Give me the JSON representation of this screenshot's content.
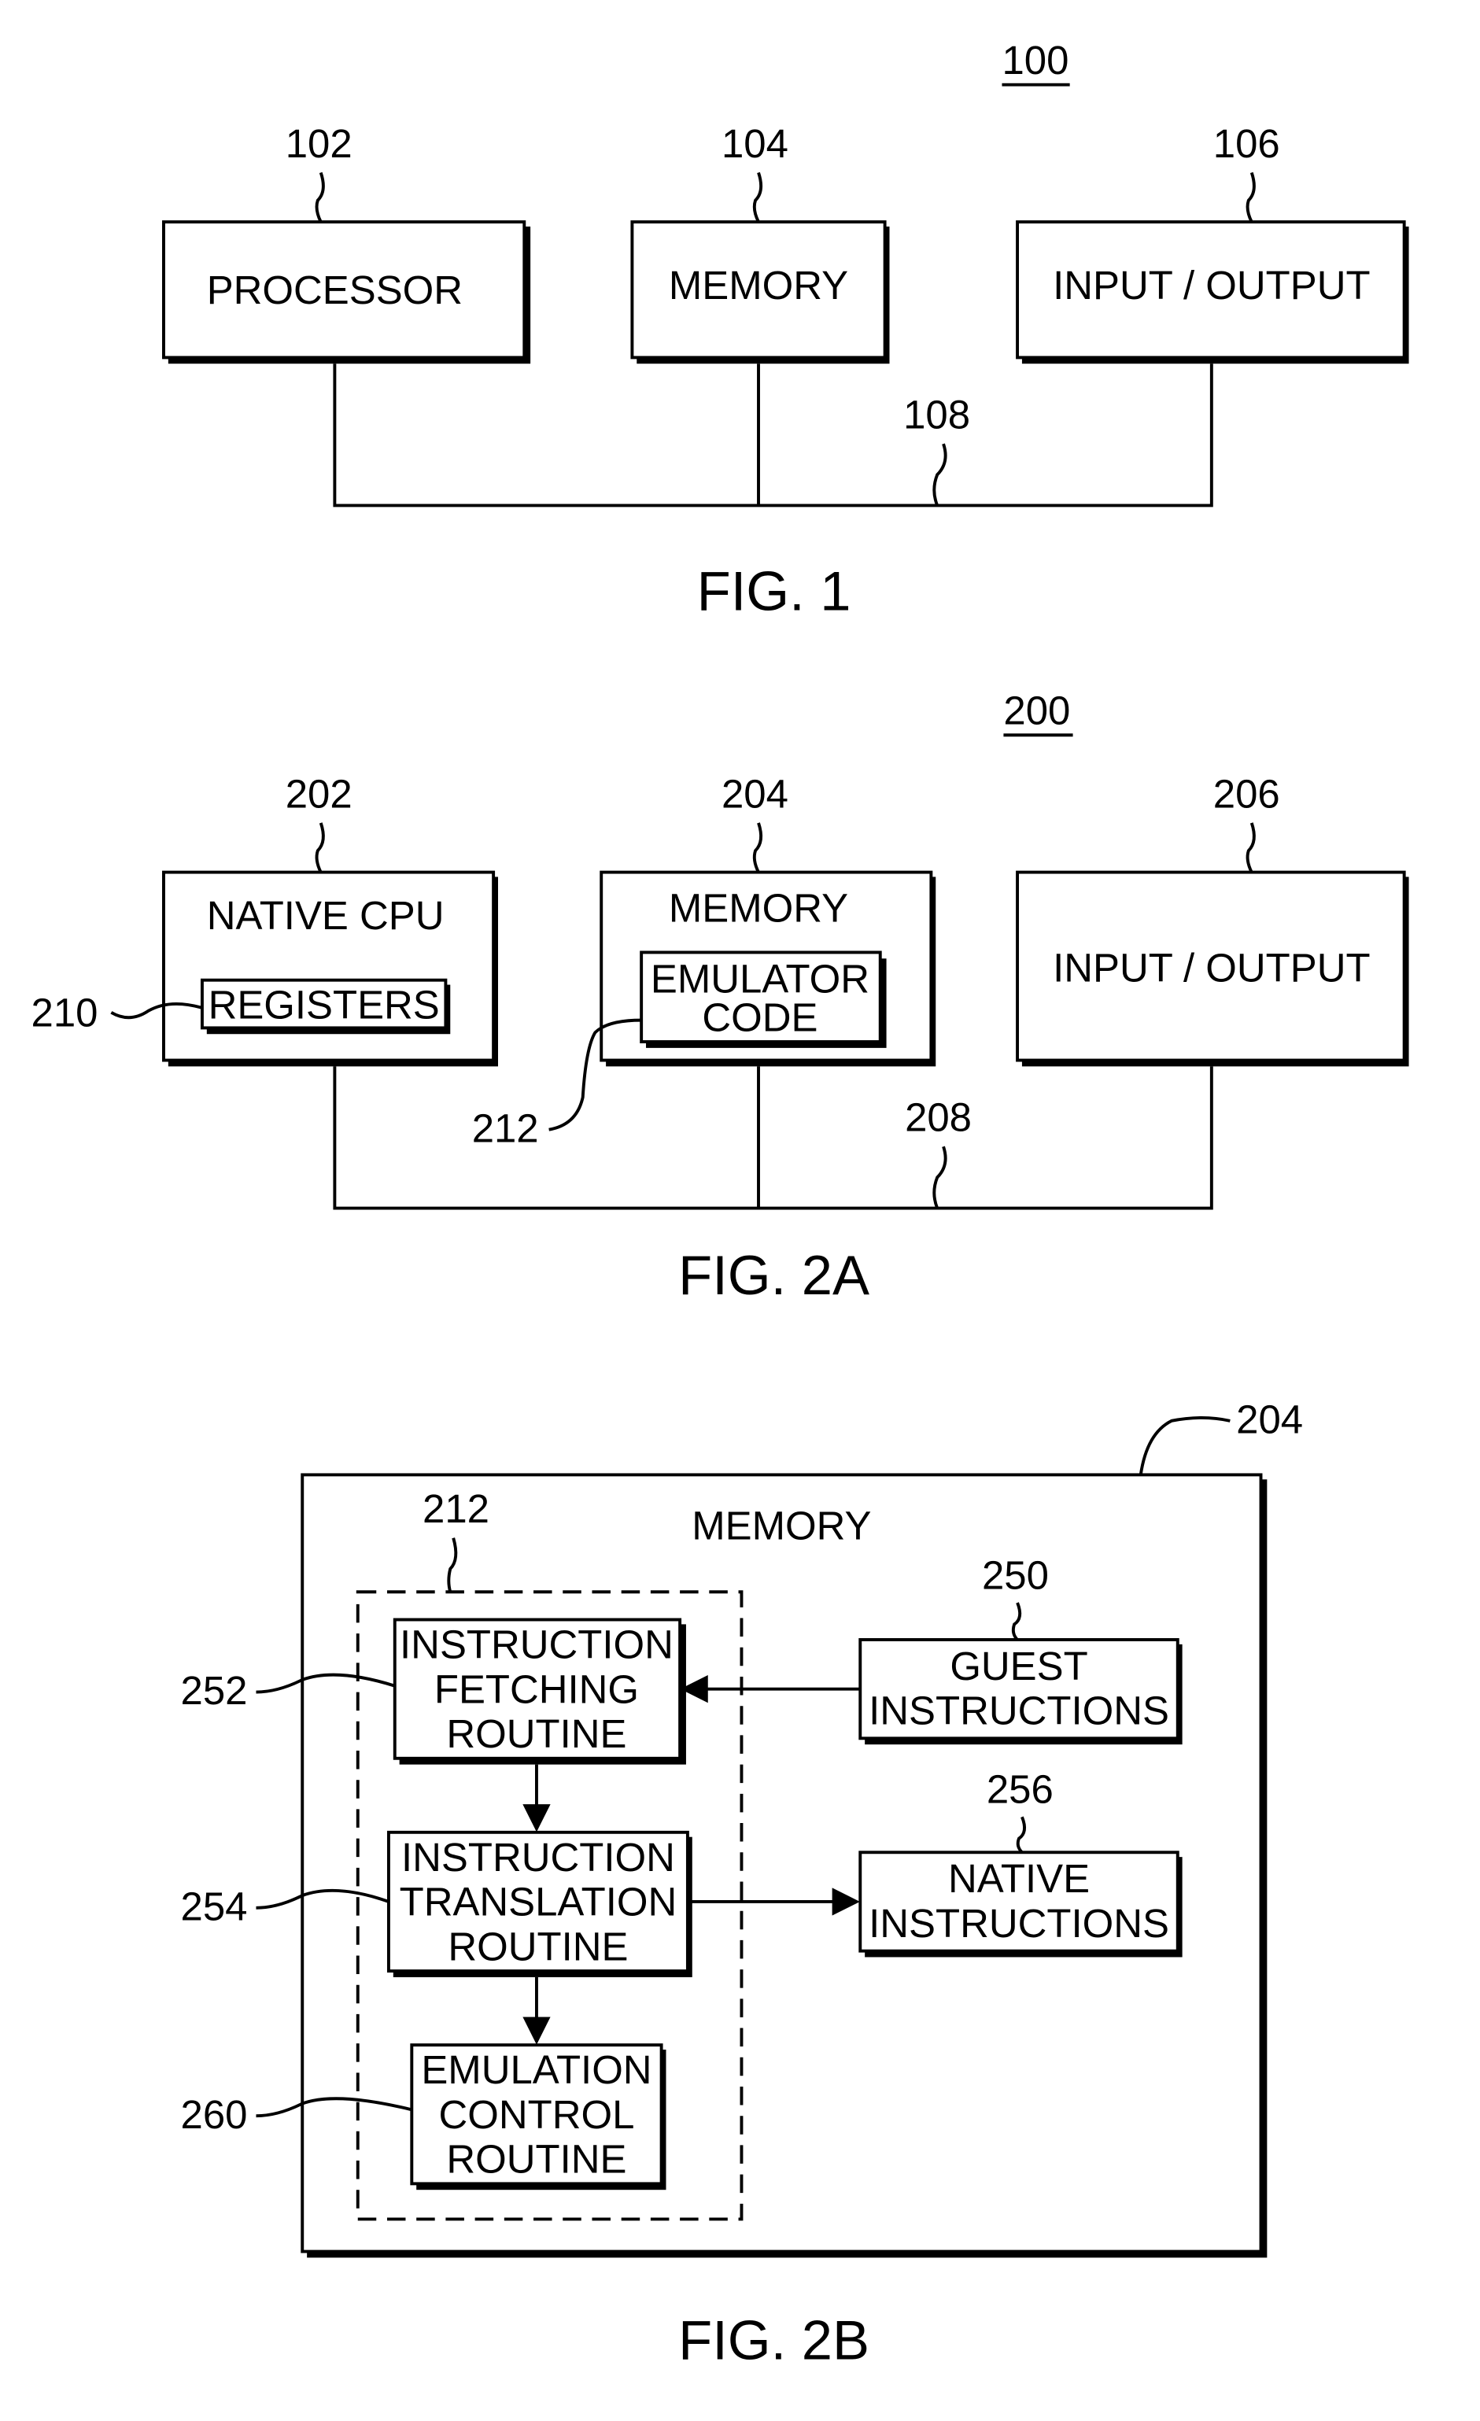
{
  "fig1": {
    "ref_overall": "100",
    "processor": {
      "ref": "102",
      "label": "PROCESSOR"
    },
    "memory": {
      "ref": "104",
      "label": "MEMORY"
    },
    "io": {
      "ref": "106",
      "label": "INPUT / OUTPUT"
    },
    "bus_ref": "108",
    "caption": "FIG. 1"
  },
  "fig2a": {
    "ref_overall": "200",
    "cpu": {
      "ref": "202",
      "label": "NATIVE CPU"
    },
    "registers": {
      "ref": "210",
      "label": "REGISTERS"
    },
    "memory": {
      "ref": "204",
      "label": "MEMORY"
    },
    "emulator": {
      "ref": "212",
      "label_line1": "EMULATOR",
      "label_line2": "CODE"
    },
    "io": {
      "ref": "206",
      "label": "INPUT / OUTPUT"
    },
    "bus_ref": "208",
    "caption": "FIG. 2A"
  },
  "fig2b": {
    "memory": {
      "ref": "204",
      "label": "MEMORY"
    },
    "emulator_group_ref": "212",
    "fetching": {
      "ref": "252",
      "lines": [
        "INSTRUCTION",
        "FETCHING",
        "ROUTINE"
      ]
    },
    "translation": {
      "ref": "254",
      "lines": [
        "INSTRUCTION",
        "TRANSLATION",
        "ROUTINE"
      ]
    },
    "control": {
      "ref": "260",
      "lines": [
        "EMULATION",
        "CONTROL",
        "ROUTINE"
      ]
    },
    "guest": {
      "ref": "250",
      "lines": [
        "GUEST",
        "INSTRUCTIONS"
      ]
    },
    "native": {
      "ref": "256",
      "lines": [
        "NATIVE",
        "INSTRUCTIONS"
      ]
    },
    "caption": "FIG. 2B"
  }
}
